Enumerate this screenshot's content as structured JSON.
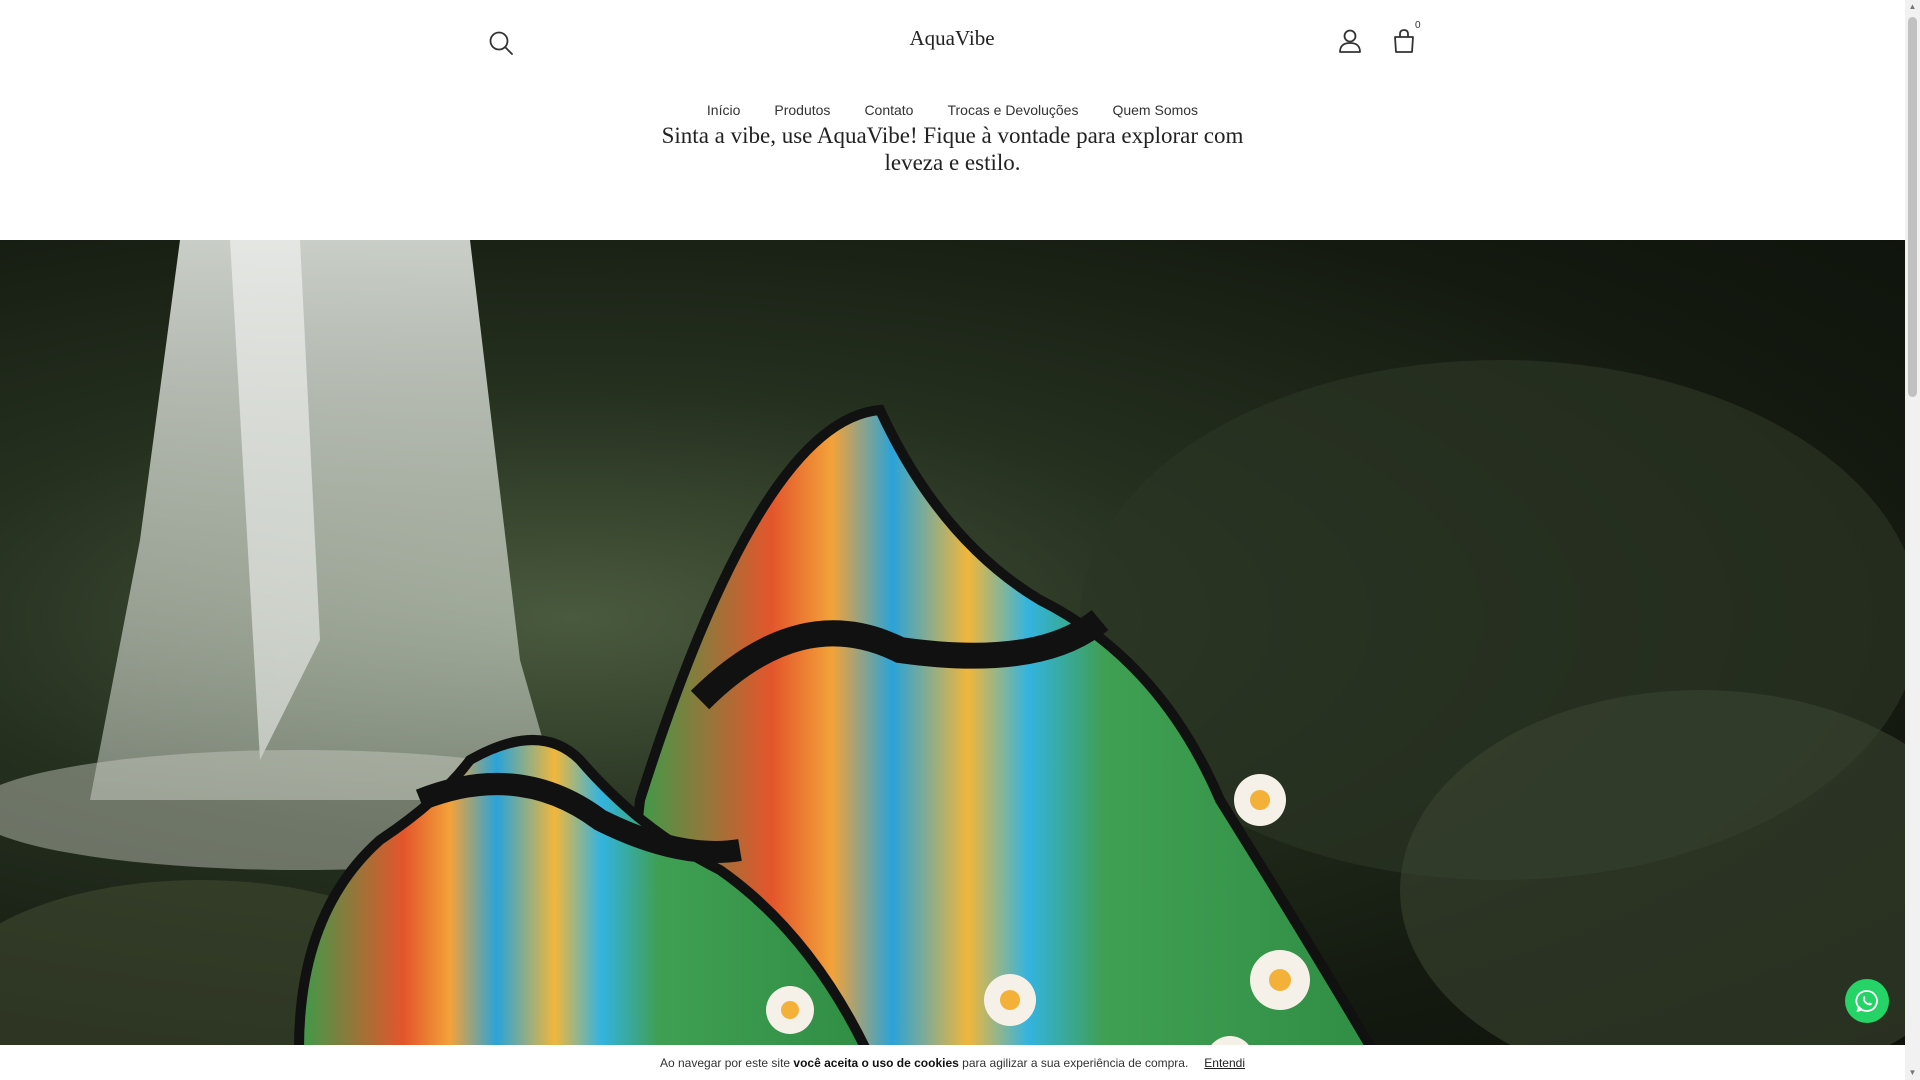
{
  "header": {
    "logo": "AquaVibe",
    "cart_count": "0",
    "icons": {
      "search": "search-icon",
      "account": "user-icon",
      "cart": "shopping-bag-icon"
    }
  },
  "nav": {
    "items": [
      {
        "label": "Início"
      },
      {
        "label": "Produtos"
      },
      {
        "label": "Contato"
      },
      {
        "label": "Trocas e Devoluções"
      },
      {
        "label": "Quem Somos"
      }
    ]
  },
  "tagline": {
    "line1": "Sinta a vibe, use AquaVibe! Fique à vontade para explorar com",
    "line2": "leveza e estilo."
  },
  "hero": {
    "image": "water-shoes-waterfall-image"
  },
  "whatsapp": {
    "icon": "whatsapp-icon",
    "color": "#25d366"
  },
  "cookie": {
    "text_before": "Ao navegar por este site ",
    "text_bold": "você aceita o uso de cookies",
    "text_after": " para agilizar a sua experiência de compra.",
    "accept_label": "Entendi"
  }
}
